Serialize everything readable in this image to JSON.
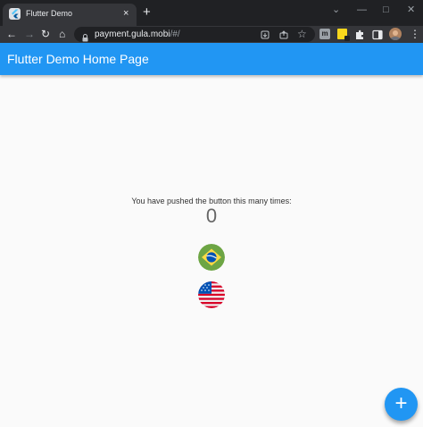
{
  "browser": {
    "tab": {
      "title": "Flutter Demo",
      "favicon": "flutter-icon",
      "close": "×"
    },
    "new_tab": "+",
    "window_controls": [
      "⌄",
      "—",
      "□",
      "✕"
    ],
    "toolbar": {
      "back": "←",
      "forward": "→",
      "reload": "↻",
      "home": "⌂",
      "url_host": "payment.gula.mobi",
      "url_path": "/#/",
      "lock_icon": "lock-icon",
      "star": "☆",
      "menu": "⋮"
    }
  },
  "app": {
    "title": "Flutter Demo Home Page",
    "primary_color": "#2196f3",
    "counter_label": "You have pushed the button this many times:",
    "counter_value": "0",
    "flags": [
      "brazil-flag-icon",
      "usa-flag-icon"
    ],
    "fab_label": "+"
  }
}
